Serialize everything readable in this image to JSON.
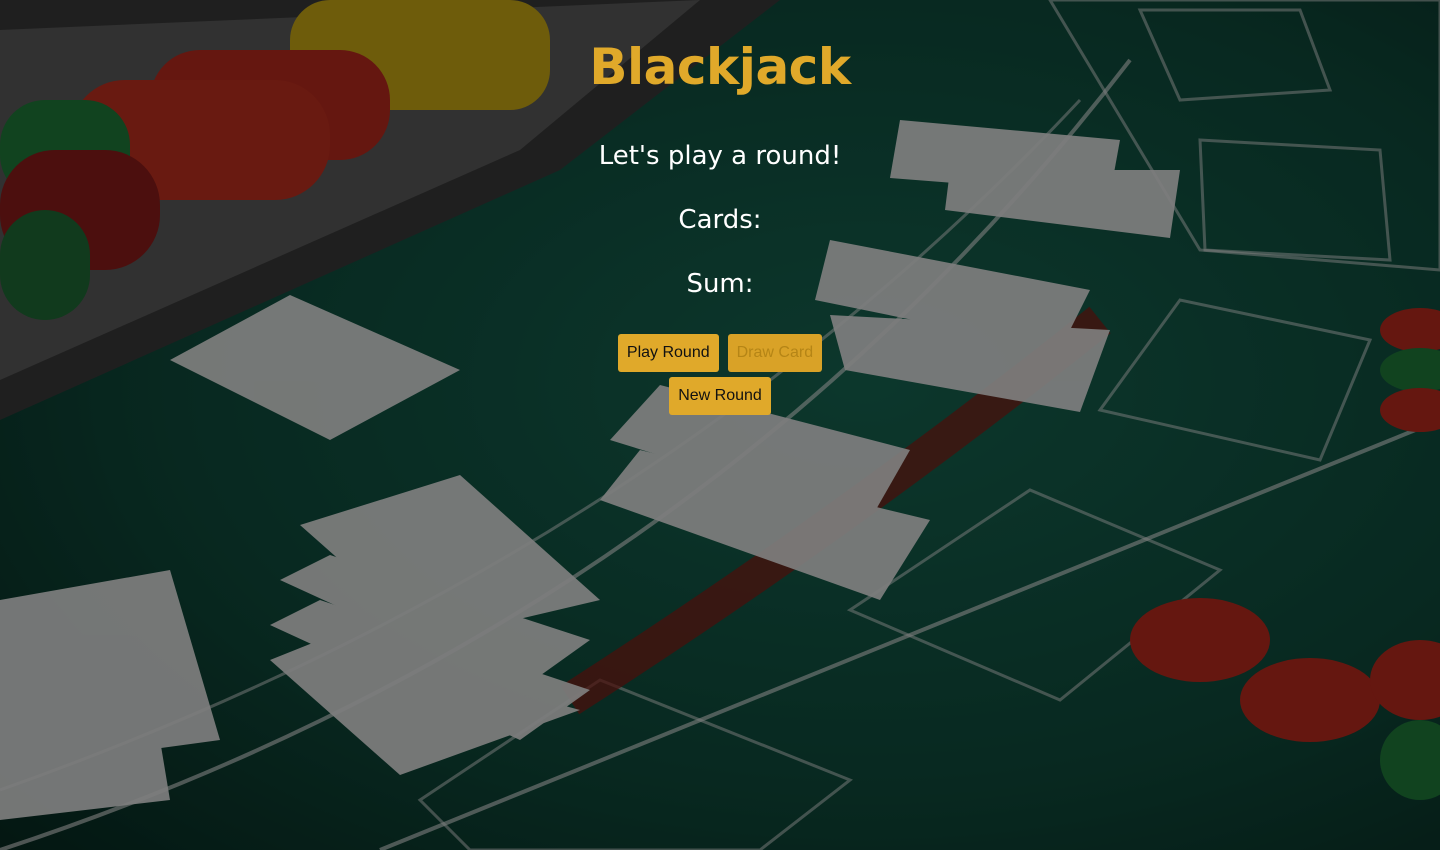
{
  "title": "Blackjack",
  "message": "Let's play a round!",
  "cards_label": "Cards:",
  "sum_label": "Sum:",
  "buttons": {
    "play_round": "Play Round",
    "draw_card": "Draw Card",
    "new_round": "New Round"
  },
  "colors": {
    "accent": "#e0a92a",
    "felt": "#0f4a3b",
    "text": "#ffffff"
  }
}
